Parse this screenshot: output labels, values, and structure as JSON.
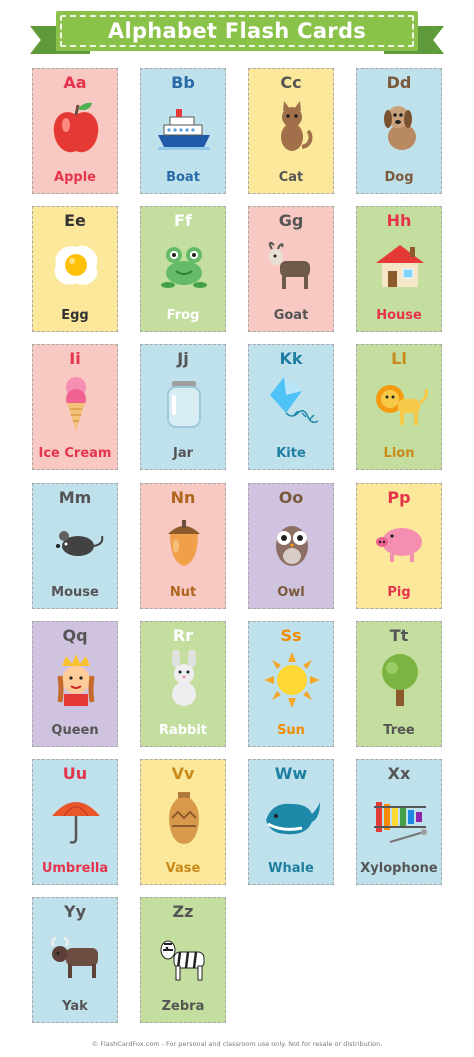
{
  "title": "Alphabet Flash Cards",
  "footer": "© FlashCardFox.com - For personal and classroom use only. Not for resale or distribution.",
  "colors": {
    "banner": "#8bc34a",
    "pink": "#f7c9c2",
    "blue": "#bfe1ec",
    "yellow": "#fbe89a",
    "green": "#c4dea0",
    "purple": "#cfc3e0"
  },
  "cards": [
    {
      "letters": "Aa",
      "word": "Apple",
      "icon": "apple-icon",
      "bg": "#f7c9c2",
      "color": "#e5354d"
    },
    {
      "letters": "Bb",
      "word": "Boat",
      "icon": "boat-icon",
      "bg": "#bfe1ec",
      "color": "#2a6aa8"
    },
    {
      "letters": "Cc",
      "word": "Cat",
      "icon": "cat-icon",
      "bg": "#fbe89a",
      "color": "#555555"
    },
    {
      "letters": "Dd",
      "word": "Dog",
      "icon": "dog-icon",
      "bg": "#bfe1ec",
      "color": "#7a5a3a"
    },
    {
      "letters": "Ee",
      "word": "Egg",
      "icon": "egg-icon",
      "bg": "#fbe89a",
      "color": "#333333"
    },
    {
      "letters": "Ff",
      "word": "Frog",
      "icon": "frog-icon",
      "bg": "#c4dea0",
      "color": "#ffffff"
    },
    {
      "letters": "Gg",
      "word": "Goat",
      "icon": "goat-icon",
      "bg": "#f7c9c2",
      "color": "#555555"
    },
    {
      "letters": "Hh",
      "word": "House",
      "icon": "house-icon",
      "bg": "#c4dea0",
      "color": "#e5354d"
    },
    {
      "letters": "Ii",
      "word": "Ice Cream",
      "icon": "ice-cream-icon",
      "bg": "#f7c9c2",
      "color": "#e5354d"
    },
    {
      "letters": "Jj",
      "word": "Jar",
      "icon": "jar-icon",
      "bg": "#bfe1ec",
      "color": "#555555"
    },
    {
      "letters": "Kk",
      "word": "Kite",
      "icon": "kite-icon",
      "bg": "#bfe1ec",
      "color": "#1f7fa0"
    },
    {
      "letters": "Ll",
      "word": "Lion",
      "icon": "lion-icon",
      "bg": "#c4dea0",
      "color": "#c98a1a"
    },
    {
      "letters": "Mm",
      "word": "Mouse",
      "icon": "mouse-icon",
      "bg": "#bfe1ec",
      "color": "#555555"
    },
    {
      "letters": "Nn",
      "word": "Nut",
      "icon": "nut-icon",
      "bg": "#f7c9c2",
      "color": "#b0651e"
    },
    {
      "letters": "Oo",
      "word": "Owl",
      "icon": "owl-icon",
      "bg": "#cfc3e0",
      "color": "#7a5a3a"
    },
    {
      "letters": "Pp",
      "word": "Pig",
      "icon": "pig-icon",
      "bg": "#fbe89a",
      "color": "#e5354d"
    },
    {
      "letters": "Qq",
      "word": "Queen",
      "icon": "queen-icon",
      "bg": "#cfc3e0",
      "color": "#555555"
    },
    {
      "letters": "Rr",
      "word": "Rabbit",
      "icon": "rabbit-icon",
      "bg": "#c4dea0",
      "color": "#ffffff"
    },
    {
      "letters": "Ss",
      "word": "Sun",
      "icon": "sun-icon",
      "bg": "#bfe1ec",
      "color": "#f08c00"
    },
    {
      "letters": "Tt",
      "word": "Tree",
      "icon": "tree-icon",
      "bg": "#c4dea0",
      "color": "#555555"
    },
    {
      "letters": "Uu",
      "word": "Umbrella",
      "icon": "umbrella-icon",
      "bg": "#bfe1ec",
      "color": "#e5354d"
    },
    {
      "letters": "Vv",
      "word": "Vase",
      "icon": "vase-icon",
      "bg": "#fbe89a",
      "color": "#c98a1a"
    },
    {
      "letters": "Ww",
      "word": "Whale",
      "icon": "whale-icon",
      "bg": "#bfe1ec",
      "color": "#1f7fa0"
    },
    {
      "letters": "Xx",
      "word": "Xylophone",
      "icon": "xylophone-icon",
      "bg": "#bfe1ec",
      "color": "#555555"
    },
    {
      "letters": "Yy",
      "word": "Yak",
      "icon": "yak-icon",
      "bg": "#bfe1ec",
      "color": "#555555"
    },
    {
      "letters": "Zz",
      "word": "Zebra",
      "icon": "zebra-icon",
      "bg": "#c4dea0",
      "color": "#555555"
    }
  ]
}
